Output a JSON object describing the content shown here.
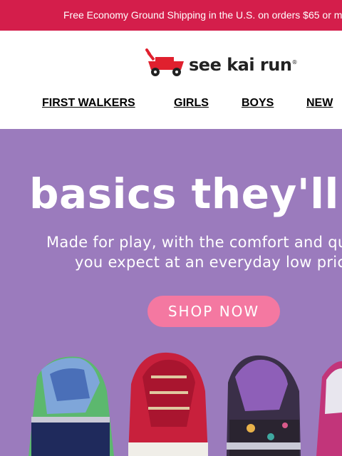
{
  "banner": {
    "text": "Free Economy Ground Shipping in the U.S. on orders $65 or m"
  },
  "brand": {
    "name": "see kai run",
    "logo_icon": "red-wagon-icon"
  },
  "nav": [
    {
      "label": "FIRST WALKERS"
    },
    {
      "label": "GIRLS"
    },
    {
      "label": "BOYS"
    },
    {
      "label": "NEW"
    }
  ],
  "hero": {
    "headline": "basics they'll lo",
    "subline_1": "Made for play, with the comfort and qu",
    "subline_2": "you expect at an everyday low pric",
    "cta_label": "SHOP NOW"
  },
  "colors": {
    "banner": "#d41e4b",
    "hero_bg": "#9b7bbd",
    "cta": "#f478a1",
    "logo_red": "#e0202e"
  }
}
